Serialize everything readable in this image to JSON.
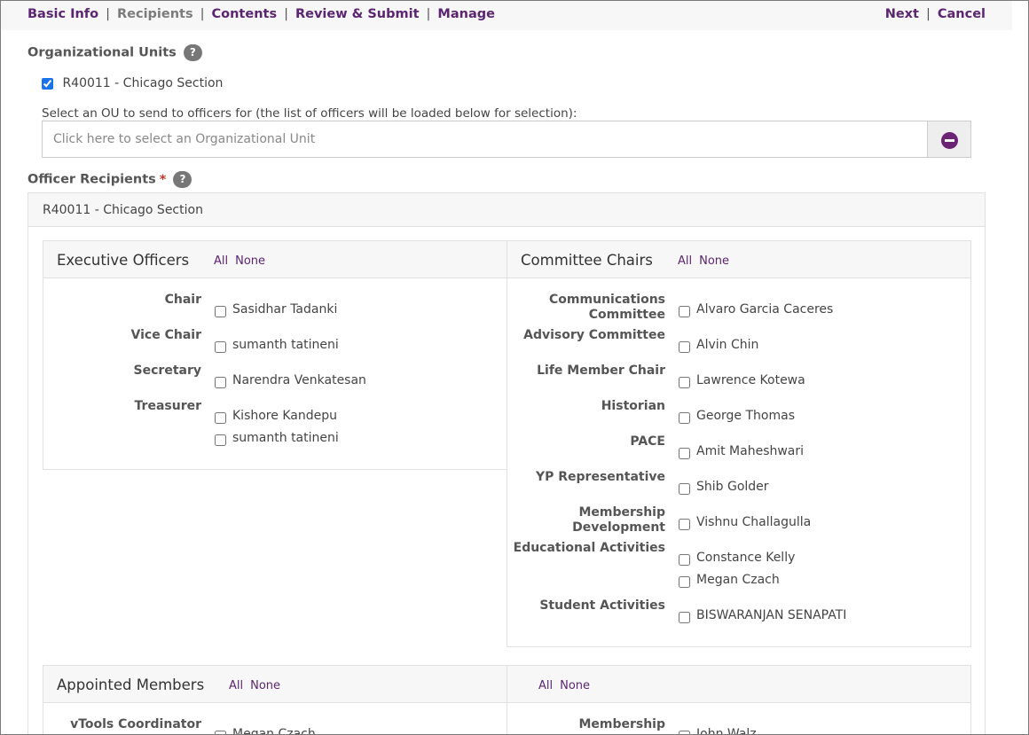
{
  "nav": {
    "steps": [
      {
        "label": "Basic Info",
        "current": false
      },
      {
        "label": "Recipients",
        "current": true
      },
      {
        "label": "Contents",
        "current": false
      },
      {
        "label": "Review & Submit",
        "current": false
      },
      {
        "label": "Manage",
        "current": false
      }
    ],
    "next": "Next",
    "cancel": "Cancel",
    "separator": "|"
  },
  "org_units": {
    "title": "Organizational Units",
    "help": "?",
    "selected_ou": "R40011 - Chicago Section",
    "select_label": "Select an OU to send to officers for (the list of officers will be loaded below for selection):",
    "input_placeholder": "Click here to select an Organizational Unit",
    "input_value": ""
  },
  "officers": {
    "title": "Officer Recipients",
    "required_mark": "*",
    "help": "?",
    "section_name": "R40011 - Chicago Section",
    "all_label": "All",
    "none_label": "None",
    "executive": {
      "title": "Executive Officers",
      "roles": [
        {
          "label": "Chair",
          "members": [
            "Sasidhar Tadanki"
          ]
        },
        {
          "label": "Vice Chair",
          "members": [
            "sumanth tatineni"
          ]
        },
        {
          "label": "Secretary",
          "members": [
            "Narendra Venkatesan"
          ]
        },
        {
          "label": "Treasurer",
          "members": [
            "Kishore Kandepu",
            "sumanth tatineni"
          ]
        }
      ]
    },
    "committee": {
      "title": "Committee Chairs",
      "roles": [
        {
          "label": "Communications Committee",
          "members": [
            "Alvaro Garcia Caceres"
          ]
        },
        {
          "label": "Advisory Committee",
          "members": [
            "Alvin Chin"
          ]
        },
        {
          "label": "Life Member Chair",
          "members": [
            "Lawrence Kotewa"
          ]
        },
        {
          "label": "Historian",
          "members": [
            "George Thomas"
          ]
        },
        {
          "label": "PACE",
          "members": [
            "Amit Maheshwari"
          ]
        },
        {
          "label": "YP Representative",
          "members": [
            "Shib Golder"
          ]
        },
        {
          "label": "Membership Development",
          "members": [
            "Vishnu Challagulla"
          ]
        },
        {
          "label": "Educational Activities",
          "members": [
            "Constance Kelly",
            "Megan Czach"
          ]
        },
        {
          "label": "Student Activities",
          "members": [
            "BISWARANJAN SENAPATI"
          ]
        }
      ]
    },
    "appointed": {
      "title": "Appointed Members",
      "roles": [
        {
          "label": "vTools Coordinator",
          "members": [
            "Megan Czach"
          ]
        }
      ]
    },
    "appointed_right": {
      "title": "",
      "roles": [
        {
          "label": "Membership",
          "members": [
            "John Walz"
          ]
        }
      ]
    }
  }
}
